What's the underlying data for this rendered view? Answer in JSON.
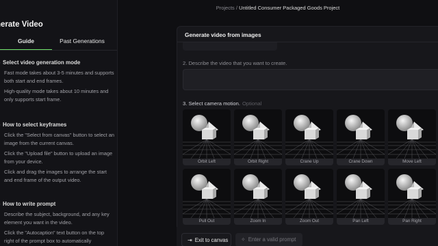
{
  "sidebar": {
    "title": "nerate Video",
    "tabs": [
      {
        "label": "Guide"
      },
      {
        "label": "Past Generations"
      }
    ],
    "sections": [
      {
        "heading": "Select video generation mode",
        "paragraphs": [
          "Fast mode takes about 3-5 minutes and supports both start and end frames.",
          "High-quality mode takes about 10 minutes and only supports start frame."
        ]
      },
      {
        "heading": "How to select keyframes",
        "paragraphs": [
          "Click the \"Select from canvas\" button to select an image from the current canvas.",
          "Click the \"Upload file\" button to upload an image from your device.",
          "Click and drag the images to arrange the start and end frame of the output video."
        ]
      },
      {
        "heading": "How to write prompt",
        "paragraphs": [
          "Describe the subject, background, and any key element you want in the video.",
          "Click the \"Autocaption\" text button on the top right of the prompt box to automatically"
        ]
      }
    ]
  },
  "breadcrumb": {
    "root": "Projects",
    "separator": "/",
    "current": "Untitled Consumer Packaged Goods Project"
  },
  "panel": {
    "title": "Generate video from images",
    "step2_label": "2. Describe the video that you want to create.",
    "prompt_value": "",
    "step3_label": "3. Select camera motion.",
    "step3_optional": "Optional",
    "camera_motions": [
      {
        "label": "Orbit Left"
      },
      {
        "label": "Orbit Right"
      },
      {
        "label": "Crane Up"
      },
      {
        "label": "Crane Down"
      },
      {
        "label": "Move Left"
      },
      {
        "label": "Pull Out"
      },
      {
        "label": "Zoom In"
      },
      {
        "label": "Zoom Out"
      },
      {
        "label": "Pan Left"
      },
      {
        "label": "Pan Right"
      }
    ]
  },
  "footer": {
    "exit_label": "Exit to canvas",
    "exit_icon": "exit-icon",
    "generate_label": "Enter a valid prompt",
    "generate_icon": "sparkle-icon"
  },
  "colors": {
    "accent": "#6fe36a",
    "background": "#0f0f12",
    "panel": "#17171b"
  }
}
